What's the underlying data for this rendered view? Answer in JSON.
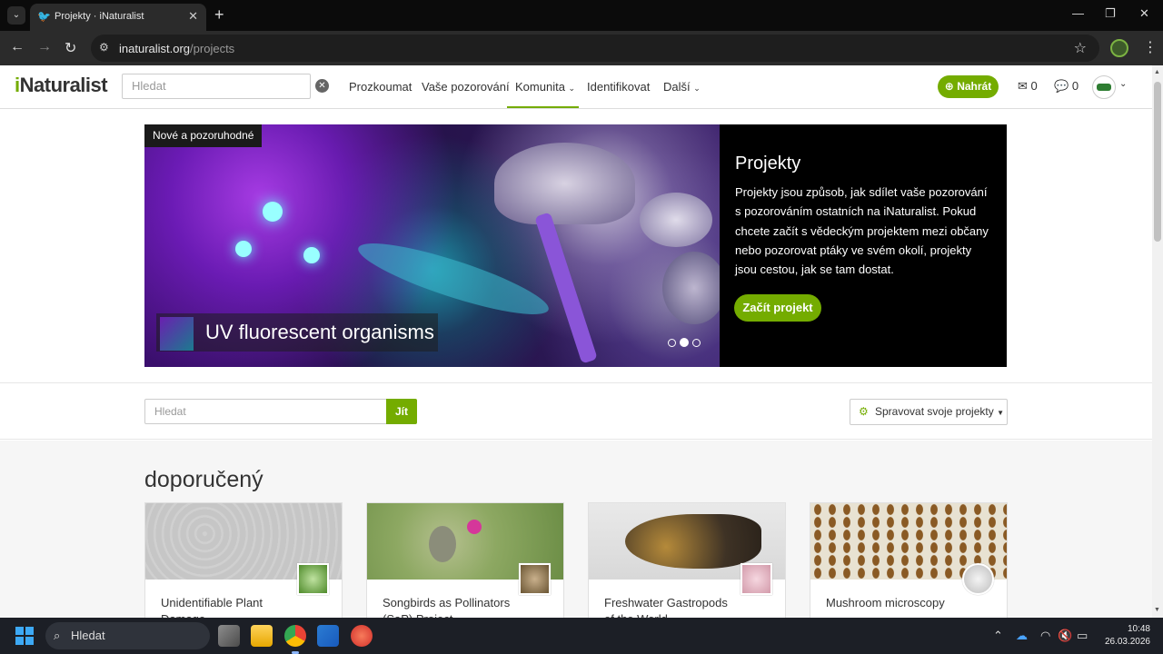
{
  "browser": {
    "tab_title": "Projekty · iNaturalist",
    "url_host": "inaturalist.org",
    "url_path": "/projects"
  },
  "header": {
    "logo_i": "i",
    "logo_rest": "Naturalist",
    "search_placeholder": "Hledat",
    "nav": [
      "Prozkoumat",
      "Vaše pozorování",
      "Komunita",
      "Identifikovat",
      "Další"
    ],
    "upload_label": "Nahrát",
    "messages_count": "0",
    "notifications_count": "0"
  },
  "hero": {
    "tag": "Nové a pozoruhodné",
    "caption": "UV fluorescent organisms",
    "title": "Projekty",
    "description": "Projekty jsou způsob, jak sdílet vaše pozorování s pozorováním ostatních na iNaturalist. Pokud chcete začít s vědeckým projektem mezi občany nebo pozorovat ptáky ve svém okolí, projekty jsou cestou, jak se tam dostat.",
    "cta_label": "Začít projekt",
    "active_slide": 2,
    "slide_count": 3
  },
  "project_search": {
    "placeholder": "Hledat",
    "go_label": "Jít",
    "manage_label": "Spravovat svoje projekty"
  },
  "featured": {
    "heading": "doporučený",
    "cards": [
      {
        "title": "Unidentifiable Plant Damage"
      },
      {
        "title": "Songbirds as Pollinators (SaP) Project"
      },
      {
        "title": "Freshwater Gastropods of the World"
      },
      {
        "title": "Mushroom microscopy"
      }
    ]
  },
  "taskbar": {
    "search_label": "Hledat",
    "time": "10:48",
    "date": "26.03.2026"
  },
  "colors": {
    "brand_green": "#74ac00",
    "chrome_dark": "#2b2b2b",
    "taskbar": "#1c1f26"
  }
}
